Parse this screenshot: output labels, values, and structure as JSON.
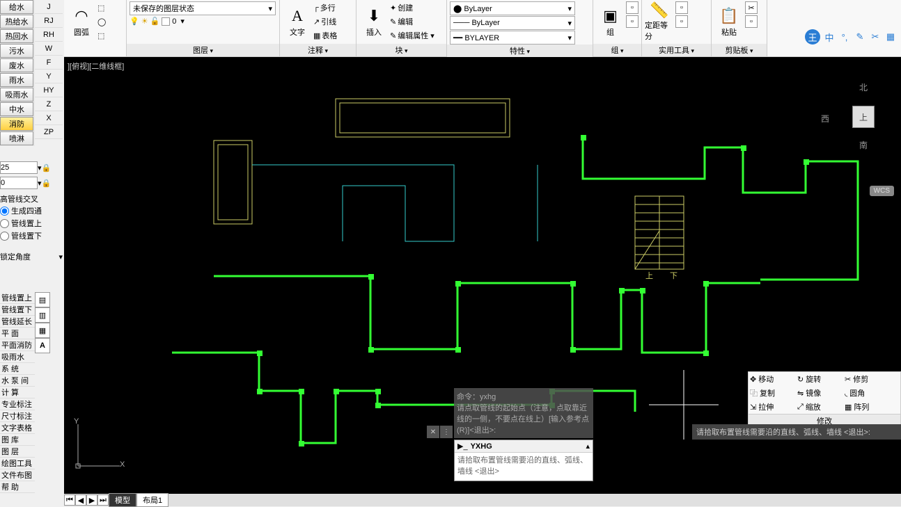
{
  "viewport_label": "][俯视][二维线框]",
  "ribbon": {
    "arc_label": "圆弧",
    "layer": {
      "state": "未保存的图层状态",
      "label": "图层"
    },
    "annotate": {
      "text": "文字",
      "leader": "引线",
      "table": "表格",
      "multiline": "多行",
      "label": "注释"
    },
    "block": {
      "insert": "插入",
      "create": "创建",
      "edit": "编辑",
      "editattr": "编辑属性 ▾",
      "label": "块"
    },
    "properties": {
      "bylayer1": "ByLayer",
      "bylayer2": "ByLayer",
      "bylayer3": "BYLAYER",
      "label": "特性"
    },
    "group": {
      "big": "组",
      "label": "组"
    },
    "utility": {
      "measure": "定距等分",
      "label": "实用工具"
    },
    "clip": {
      "paste": "粘贴",
      "label": "剪贴板"
    }
  },
  "left_types": [
    "给水",
    "热给水",
    "热回水",
    "污水",
    "废水",
    "雨水",
    "吸雨水",
    "中水",
    "消防",
    "喷淋"
  ],
  "left_letters": [
    "J",
    "RJ",
    "RH",
    "W",
    "F",
    "Y",
    "HY",
    "Z",
    "X",
    "ZP"
  ],
  "spin1": "25",
  "spin2": "0",
  "cross_label": "高管线交叉",
  "radios": {
    "r1": "生成四通",
    "r2": "管线置上",
    "r3": "管线置下"
  },
  "lock_angle": "锁定角度",
  "side_cmds": [
    "管线置上",
    "管线置下",
    "管线延长",
    "平  面",
    "平面消防",
    "吸雨水",
    "系  统",
    "水 泵 间",
    "计  算",
    "专业标注",
    "尺寸标注",
    "文字表格",
    "图  库",
    "图  层",
    "绘图工具",
    "文件布图",
    "帮  助"
  ],
  "nav": {
    "n": "北",
    "w": "西",
    "s": "南",
    "face": "上",
    "wcs": "WCS"
  },
  "ucs": {
    "x": "X",
    "y": "Y"
  },
  "cmd": {
    "hist1": "命令：yxhg",
    "hist2": "请点取管线的起始点（注意，点取靠近线的一侧，不要点在线上）[输入参考点(R)]<退出>:",
    "cmd_name": "YXHG",
    "prompt": "请拾取布置管线需要沿的直线、弧线、墙线 <退出>"
  },
  "modify": {
    "move": "移动",
    "rotate": "旋转",
    "trim": "修剪",
    "copy": "复制",
    "mirror": "镜像",
    "fillet": "圆角",
    "stretch": "拉伸",
    "scale": "缩放",
    "array": "阵列",
    "label": "修改"
  },
  "status_hint": "请拾取布置管线需要沿的直线、弧线、墙线 <退出>:",
  "tabs": {
    "model": "模型",
    "layout1": "布局1"
  },
  "stair": {
    "up": "上",
    "down": "下"
  },
  "watermark_main": "王"
}
